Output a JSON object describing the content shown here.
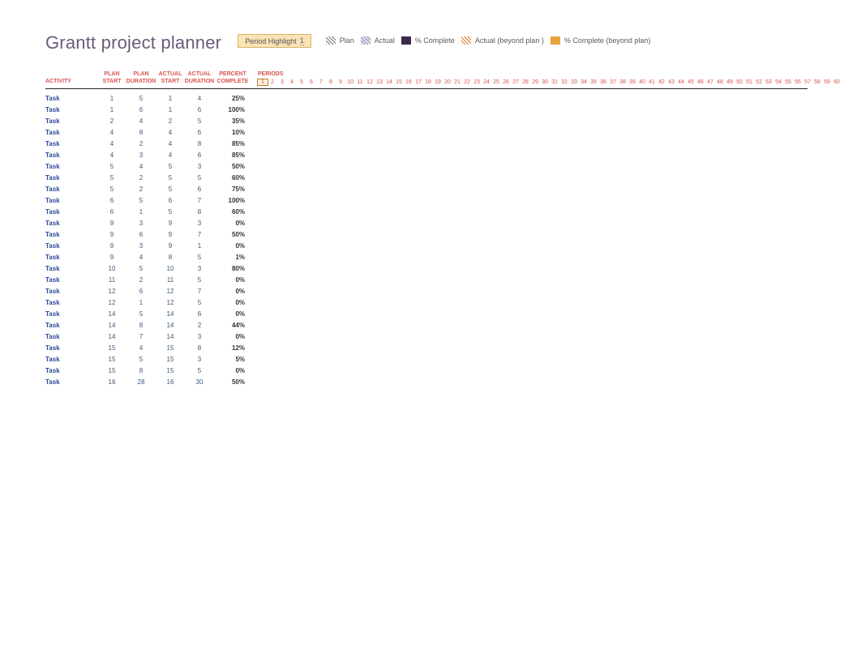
{
  "title": "Grantt project planner",
  "legend": {
    "highlight_label": "Period Highlight",
    "highlight_value": "1",
    "items": [
      {
        "key": "plan",
        "label": "Plan"
      },
      {
        "key": "actual",
        "label": "Actual"
      },
      {
        "key": "pcomp",
        "label": "% Complete"
      },
      {
        "key": "actbp",
        "label": "Actual (beyond plan )"
      },
      {
        "key": "pcbp",
        "label": "% Complete (beyond plan)"
      }
    ]
  },
  "columns": {
    "activity": "ACTIVITY",
    "plan_start_l1": "PLAN",
    "plan_start_l2": "START",
    "plan_dur_l1": "PLAN",
    "plan_dur_l2": "DURATION",
    "act_start_l1": "ACTUAL",
    "act_start_l2": "START",
    "act_dur_l1": "ACTUAL",
    "act_dur_l2": "DURATION",
    "pct_l1": "PERCENT",
    "pct_l2": "COMPLETE",
    "periods": "PERIODS"
  },
  "periods": [
    "1",
    "2",
    "3",
    "4",
    "5",
    "6",
    "7",
    "8",
    "9",
    "10",
    "11",
    "12",
    "13",
    "14",
    "15",
    "16",
    "17",
    "18",
    "19",
    "20",
    "21",
    "22",
    "23",
    "24",
    "25",
    "26",
    "27",
    "28",
    "29",
    "30",
    "31",
    "32",
    "33",
    "34",
    "35",
    "36",
    "37",
    "38",
    "39",
    "40",
    "41",
    "42",
    "43",
    "44",
    "45",
    "46",
    "47",
    "48",
    "49",
    "50",
    "51",
    "52",
    "53",
    "54",
    "55",
    "56",
    "57",
    "58",
    "59",
    "60"
  ],
  "selected_period_index": 0,
  "rows": [
    {
      "activity": "Task",
      "ps": "1",
      "pd": "5",
      "as": "1",
      "ad": "4",
      "pc": "25%"
    },
    {
      "activity": "Task",
      "ps": "1",
      "pd": "6",
      "as": "1",
      "ad": "6",
      "pc": "100%"
    },
    {
      "activity": "Task",
      "ps": "2",
      "pd": "4",
      "as": "2",
      "ad": "5",
      "pc": "35%"
    },
    {
      "activity": "Task",
      "ps": "4",
      "pd": "8",
      "as": "4",
      "ad": "6",
      "pc": "10%"
    },
    {
      "activity": "Task",
      "ps": "4",
      "pd": "2",
      "as": "4",
      "ad": "8",
      "pc": "85%"
    },
    {
      "activity": "Task",
      "ps": "4",
      "pd": "3",
      "as": "4",
      "ad": "6",
      "pc": "85%"
    },
    {
      "activity": "Task",
      "ps": "5",
      "pd": "4",
      "as": "5",
      "ad": "3",
      "pc": "50%"
    },
    {
      "activity": "Task",
      "ps": "5",
      "pd": "2",
      "as": "5",
      "ad": "5",
      "pc": "60%"
    },
    {
      "activity": "Task",
      "ps": "5",
      "pd": "2",
      "as": "5",
      "ad": "6",
      "pc": "75%"
    },
    {
      "activity": "Task",
      "ps": "6",
      "pd": "5",
      "as": "6",
      "ad": "7",
      "pc": "100%"
    },
    {
      "activity": "Task",
      "ps": "6",
      "pd": "1",
      "as": "5",
      "ad": "8",
      "pc": "60%"
    },
    {
      "activity": "Task",
      "ps": "9",
      "pd": "3",
      "as": "9",
      "ad": "3",
      "pc": "0%"
    },
    {
      "activity": "Task",
      "ps": "9",
      "pd": "6",
      "as": "9",
      "ad": "7",
      "pc": "50%"
    },
    {
      "activity": "Task",
      "ps": "9",
      "pd": "3",
      "as": "9",
      "ad": "1",
      "pc": "0%"
    },
    {
      "activity": "Task",
      "ps": "9",
      "pd": "4",
      "as": "8",
      "ad": "5",
      "pc": "1%"
    },
    {
      "activity": "Task",
      "ps": "10",
      "pd": "5",
      "as": "10",
      "ad": "3",
      "pc": "80%"
    },
    {
      "activity": "Task",
      "ps": "11",
      "pd": "2",
      "as": "11",
      "ad": "5",
      "pc": "0%"
    },
    {
      "activity": "Task",
      "ps": "12",
      "pd": "6",
      "as": "12",
      "ad": "7",
      "pc": "0%"
    },
    {
      "activity": "Task",
      "ps": "12",
      "pd": "1",
      "as": "12",
      "ad": "5",
      "pc": "0%"
    },
    {
      "activity": "Task",
      "ps": "14",
      "pd": "5",
      "as": "14",
      "ad": "6",
      "pc": "0%"
    },
    {
      "activity": "Task",
      "ps": "14",
      "pd": "8",
      "as": "14",
      "ad": "2",
      "pc": "44%"
    },
    {
      "activity": "Task",
      "ps": "14",
      "pd": "7",
      "as": "14",
      "ad": "3",
      "pc": "0%"
    },
    {
      "activity": "Task",
      "ps": "15",
      "pd": "4",
      "as": "15",
      "ad": "8",
      "pc": "12%"
    },
    {
      "activity": "Task",
      "ps": "15",
      "pd": "5",
      "as": "15",
      "ad": "3",
      "pc": "5%"
    },
    {
      "activity": "Task",
      "ps": "15",
      "pd": "8",
      "as": "15",
      "ad": "5",
      "pc": "0%"
    },
    {
      "activity": "Task",
      "ps": "16",
      "pd": "28",
      "as": "16",
      "ad": "30",
      "pc": "50%"
    }
  ]
}
